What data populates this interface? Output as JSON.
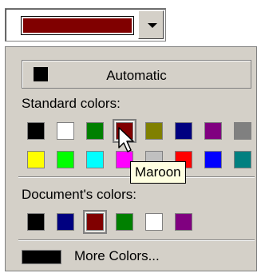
{
  "combo": {
    "current_color": "#800000",
    "button_icon": "chevron-down-icon"
  },
  "automatic": {
    "label": "Automatic",
    "color": "#000000"
  },
  "standard": {
    "label": "Standard colors:",
    "row1": [
      "#000000",
      "#ffffff",
      "#008000",
      "#800000",
      "#808000",
      "#000080",
      "#800080",
      "#808080"
    ],
    "row2": [
      "#ffff00",
      "#00ff00",
      "#00ffff",
      "#ff00ff",
      "#c0c0c0",
      "#ff0000",
      "#0000ff",
      "#008080"
    ],
    "selected": "#800000"
  },
  "document": {
    "label": "Document's colors:",
    "colors": [
      "#000000",
      "#000080",
      "#800000",
      "#008000",
      "#ffffff",
      "#800080"
    ],
    "selected": "#800000"
  },
  "more": {
    "label": "More Colors...",
    "color": "#000000"
  },
  "tooltip": {
    "text": "Maroon"
  },
  "cursor_icon": "arrow-pointer-icon"
}
